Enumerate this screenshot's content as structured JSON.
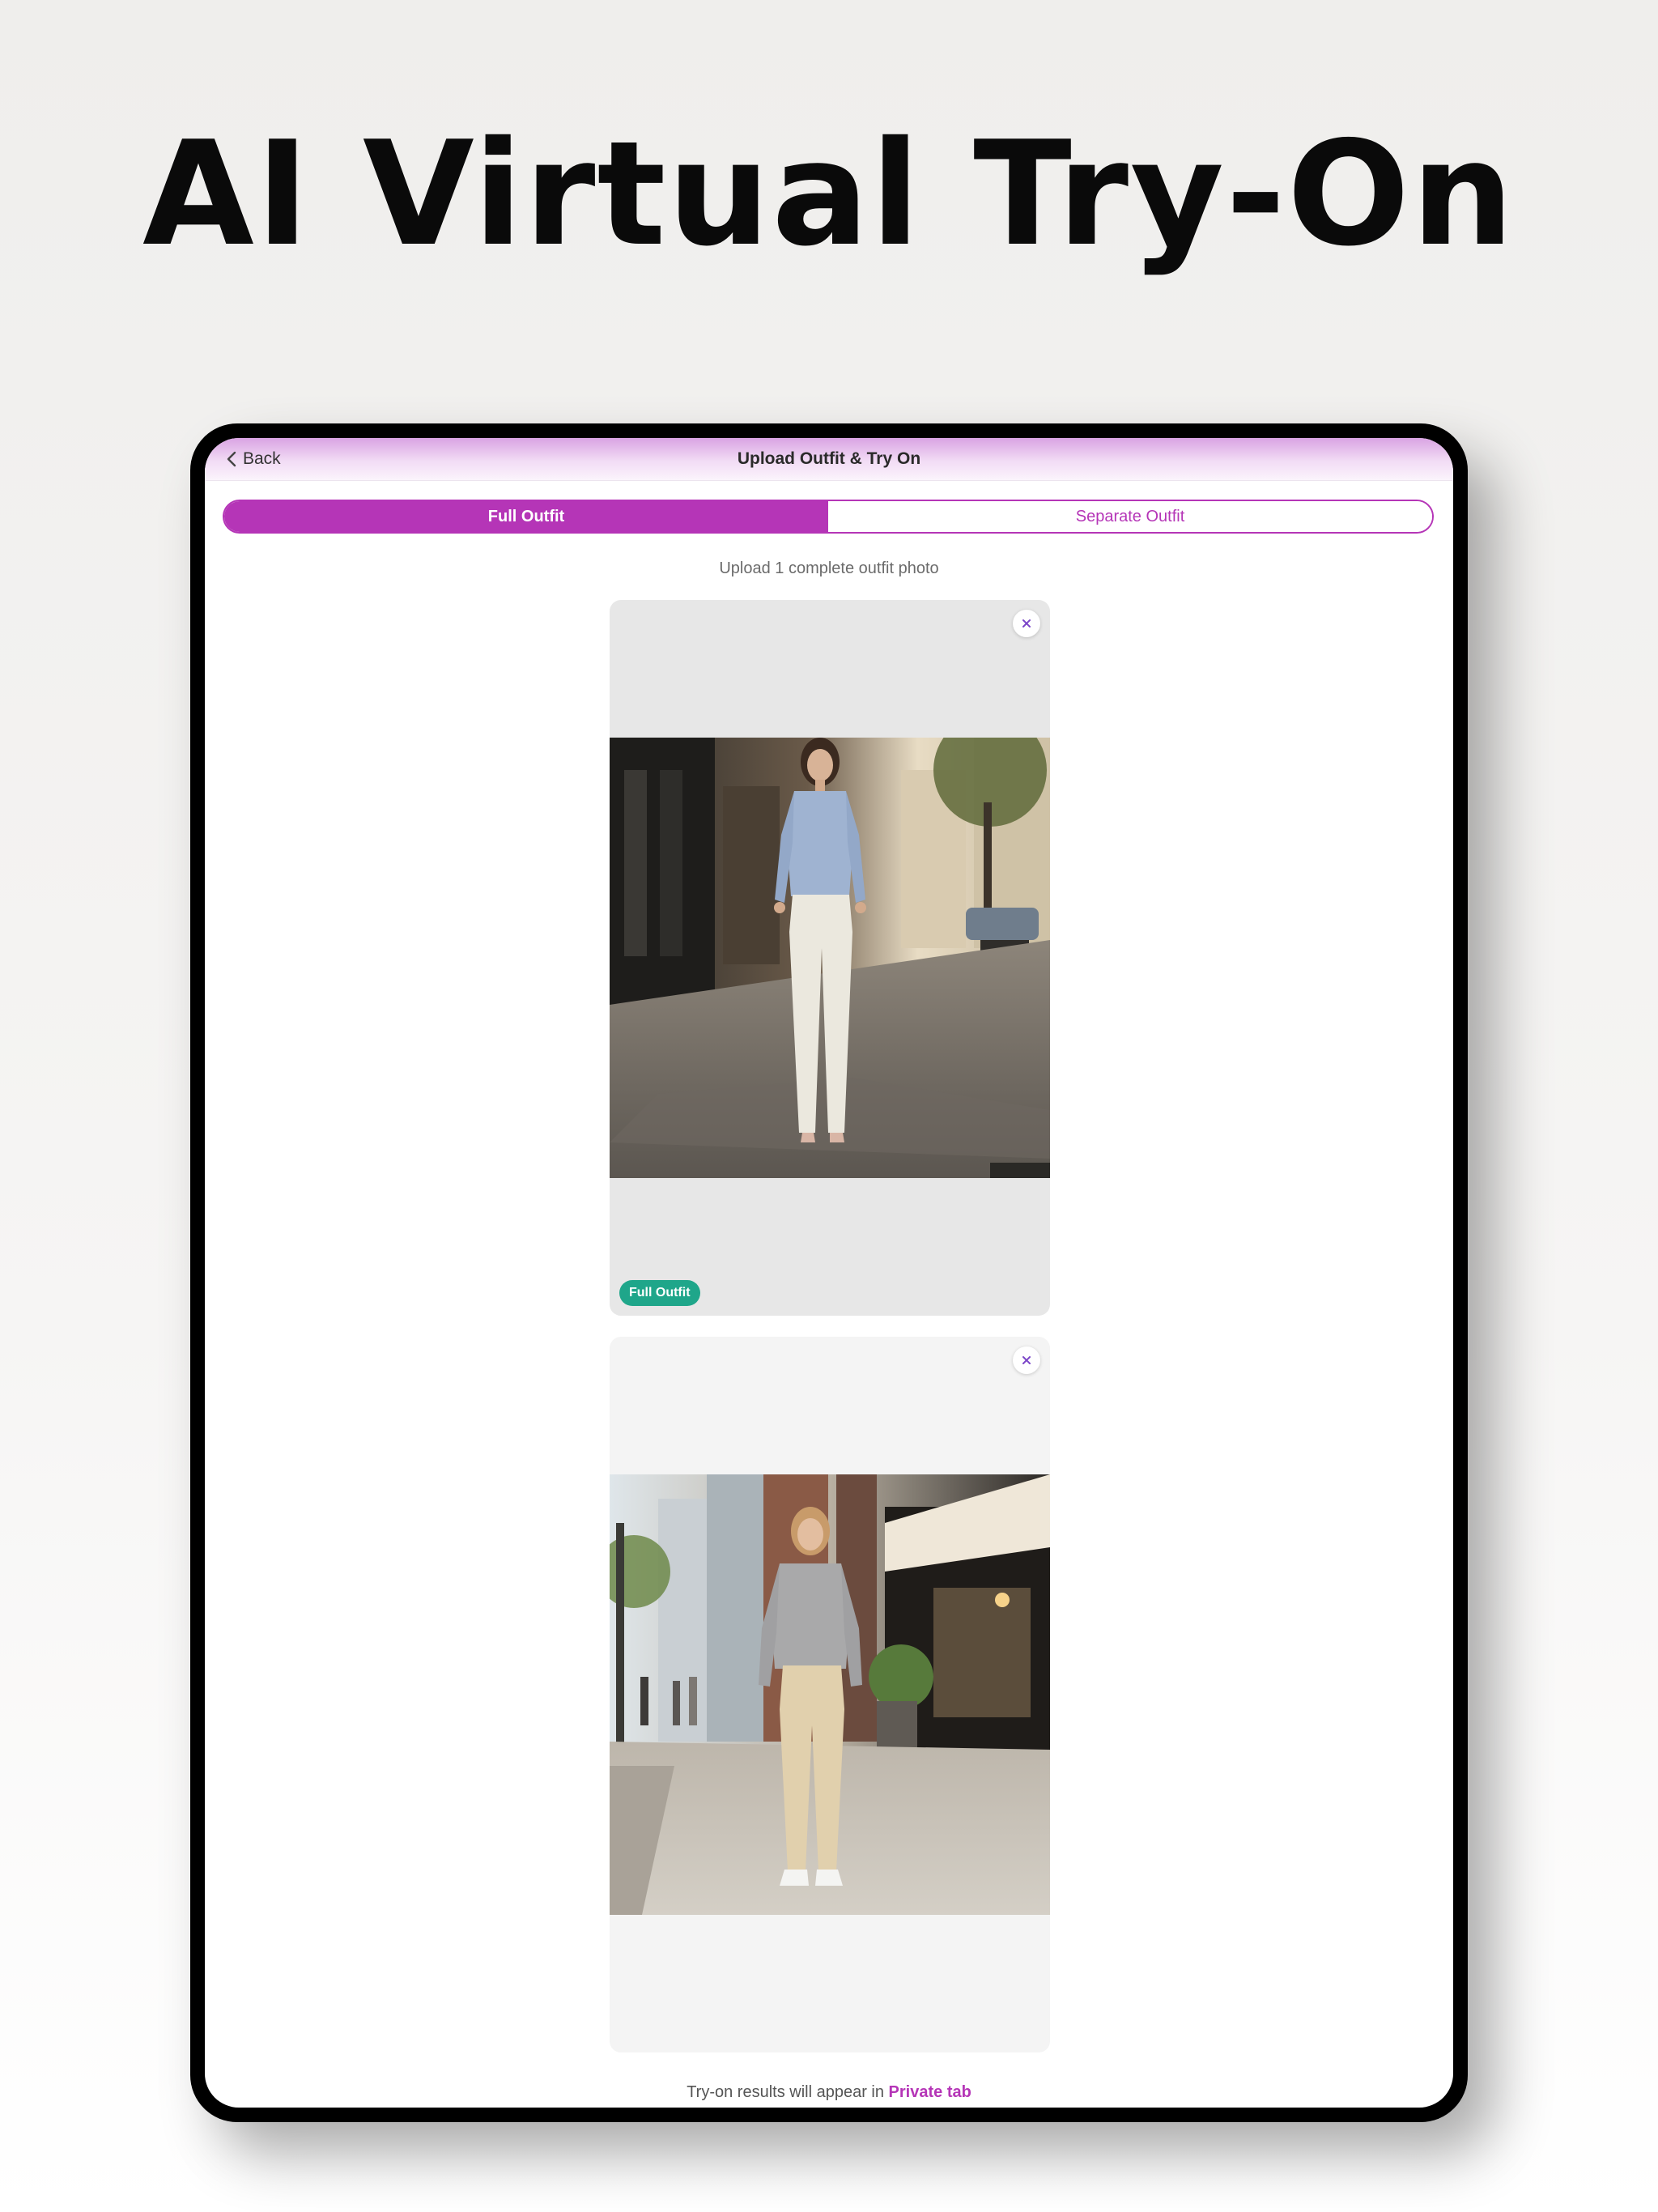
{
  "headline": "AI Virtual Try-On",
  "nav": {
    "back_label": "Back",
    "title": "Upload Outfit & Try On"
  },
  "tabs": [
    {
      "label": "Full Outfit",
      "active": true
    },
    {
      "label": "Separate Outfit",
      "active": false
    }
  ],
  "instruction": "Upload 1 complete outfit photo",
  "cards": [
    {
      "badge": "Full Outfit",
      "photo": "woman in blue satin blouse and white trousers on sidewalk"
    },
    {
      "photo": "woman in grey hoodie and beige jeans on city street"
    }
  ],
  "footer": {
    "prefix": "Try-on results will appear in ",
    "link": "Private tab"
  },
  "colors": {
    "accent": "#b535b7",
    "badge": "#1fa68a",
    "device_frame": "#000000"
  },
  "icons": {
    "back": "chevron-left-icon",
    "remove": "close-icon"
  }
}
